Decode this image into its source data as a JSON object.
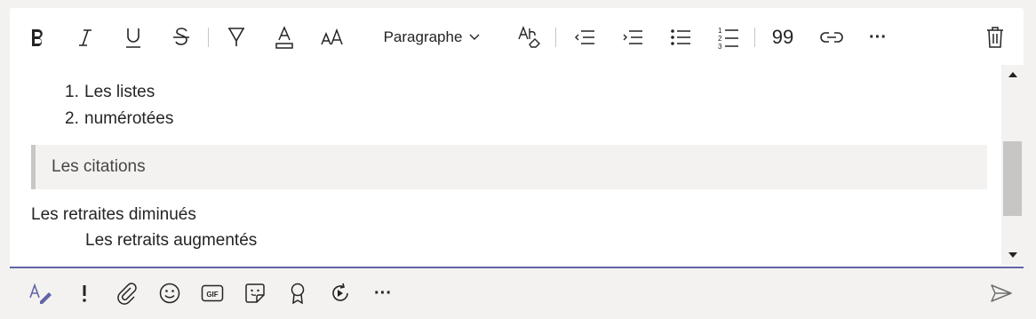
{
  "toolbar": {
    "paragraph_label": "Paragraphe",
    "quote_glyph": "99",
    "more_glyph": "···"
  },
  "content": {
    "ordered_list": [
      {
        "number": "1.",
        "text": "Les listes"
      },
      {
        "number": "2.",
        "text": "numérotées"
      }
    ],
    "quote_text": "Les citations",
    "decreased_text": "Les retraites diminués",
    "increased_text": "Les retraits augmentés"
  },
  "bottom": {
    "more_glyph": "···"
  },
  "colors": {
    "accent": "#6264a7",
    "icon": "#252423",
    "background": "#f3f2f1",
    "quote_background": "#f3f2f1",
    "scrollbar_thumb": "#c8c6c4"
  }
}
